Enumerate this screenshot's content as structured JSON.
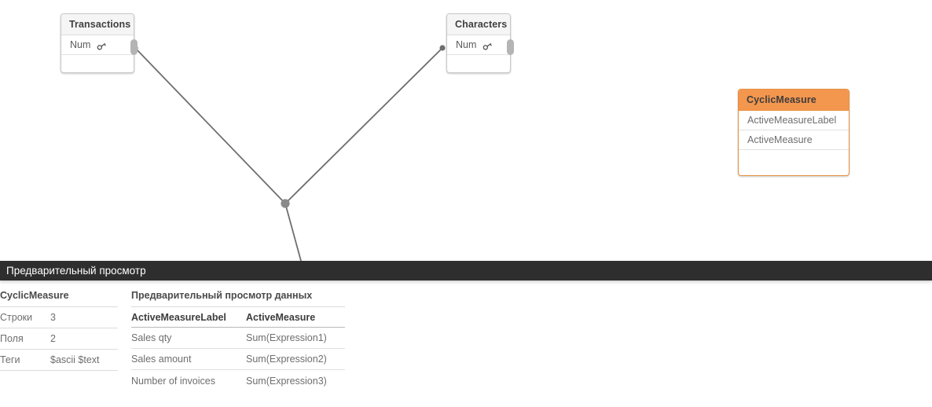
{
  "canvas": {
    "nodes": [
      {
        "id": "transactions",
        "title": "Transactions",
        "fields": [
          {
            "name": "Num",
            "icon": "key-icon"
          }
        ],
        "style": "default"
      },
      {
        "id": "characters",
        "title": "Characters",
        "fields": [
          {
            "name": "Num",
            "icon": "key-icon"
          }
        ],
        "style": "default"
      },
      {
        "id": "cyclicmeasure",
        "title": "CyclicMeasure",
        "fields": [
          {
            "name": "ActiveMeasureLabel",
            "icon": ""
          },
          {
            "name": "ActiveMeasure",
            "icon": ""
          }
        ],
        "style": "orange"
      }
    ],
    "link_color": "#6e6e6e",
    "handle_color": "#b4b4b4",
    "accent_orange": "#f3964e"
  },
  "preview": {
    "header_title": "Предварительный просмотр",
    "meta": {
      "table_name": "CyclicMeasure",
      "rows": [
        {
          "label": "Строки",
          "value": "3"
        },
        {
          "label": "Поля",
          "value": "2"
        },
        {
          "label": "Теги",
          "value": "$ascii $text"
        }
      ]
    },
    "data": {
      "title": "Предварительный просмотр данных",
      "columns": [
        "ActiveMeasureLabel",
        "ActiveMeasure"
      ],
      "rows": [
        [
          "Sales qty",
          "Sum(Expression1)"
        ],
        [
          "Sales amount",
          "Sum(Expression2)"
        ],
        [
          "Number of invoices",
          "Sum(Expression3)"
        ]
      ]
    }
  }
}
